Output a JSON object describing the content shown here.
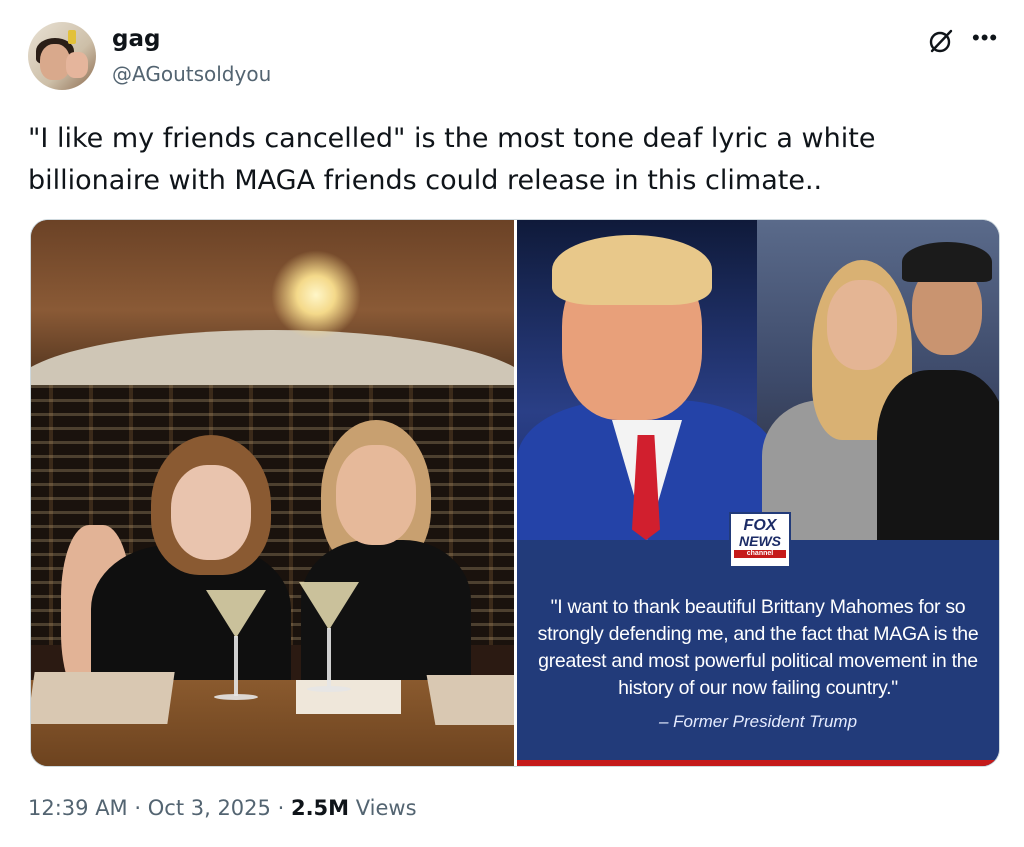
{
  "author": {
    "name": "gag",
    "handle": "@AGoutsoldyou"
  },
  "header_icons": [
    "grok-icon",
    "more-icon"
  ],
  "tweet": {
    "text": "\"I like my friends cancelled\" is the most tone deaf lyric a white billionaire with MAGA friends could release in this climate.."
  },
  "media": {
    "right_image": {
      "logo": {
        "line1": "FOX",
        "line2": "NEWS",
        "line3": "channel"
      },
      "quote": "\"I want to thank beautiful Brittany Mahomes for so strongly defending me, and the fact that MAGA is the greatest and most powerful political movement in the history of our now failing country.\"",
      "attribution": "– Former President Trump"
    }
  },
  "meta": {
    "time": "12:39 AM",
    "separator": "·",
    "date": "Oct 3, 2025",
    "views_count": "2.5M",
    "views_label": "Views"
  },
  "colors": {
    "text": "#0f1419",
    "secondary": "#536471",
    "fox_blue": "#223b7a",
    "tie_red": "#d11f2e"
  }
}
